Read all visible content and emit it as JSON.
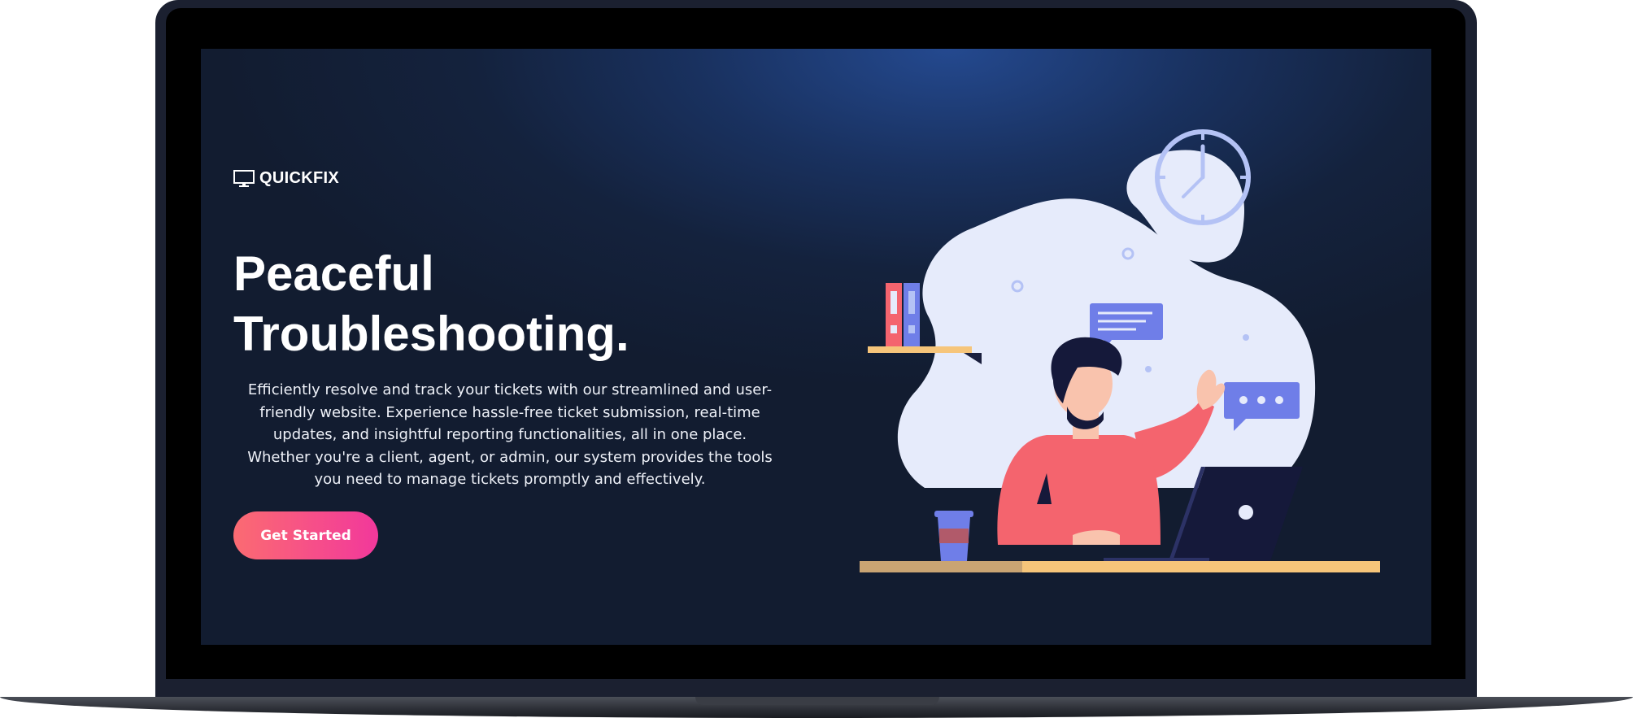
{
  "brand": {
    "name": "QUICKFIX",
    "icon": "monitor-icon"
  },
  "hero": {
    "title_line1": "Peaceful",
    "title_line2": "Troubleshooting.",
    "description": "Efficiently resolve and track your tickets with our streamlined and user-friendly website. Experience hassle-free ticket submission, real-time updates, and insightful reporting functionalities, all in one place. Whether you're a client, agent, or admin, our system provides the tools you need to manage tickets promptly and effectively.",
    "cta_label": "Get Started"
  },
  "illustration": {
    "name": "person-at-laptop-illustration",
    "icons": [
      "clock-icon",
      "chat-bubble-icon",
      "ellipsis-chat-icon",
      "binders-icon",
      "coffee-cup-icon",
      "laptop-icon"
    ]
  },
  "colors": {
    "background_dark": "#121c30",
    "background_glow": "#24498f",
    "cta_gradient_start": "#fb6b72",
    "cta_gradient_end": "#f2389b",
    "text": "#ffffff",
    "blob": "#e6ebfb",
    "accent_purple": "#6f7ee8",
    "shirt_pink": "#f4646e",
    "desk": "#f6c57a"
  }
}
